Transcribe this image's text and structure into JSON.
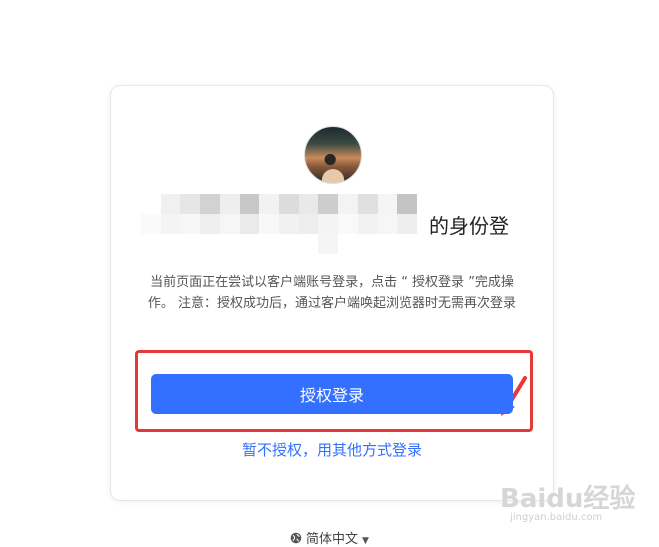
{
  "card": {
    "identity_suffix": "的身份登",
    "description": "当前页面正在尝试以客户端账号登录，点击 “ 授权登录 ”完成操作。 注意：授权成功后，通过客户端唤起浏览器时无需再次登录",
    "authorize_button_label": "授权登录",
    "alt_login_link": "暂不授权，用其他方式登录"
  },
  "footer": {
    "language_label": "简体中文"
  },
  "watermark": {
    "brand": "Baidu经验",
    "url": "jingyan.baidu.com"
  },
  "colors": {
    "accent": "#3370ff",
    "highlight_border": "#e53935",
    "annotation_arrow": "#e53935"
  },
  "icons": [
    "avatar",
    "globe-icon",
    "caret-down-icon",
    "red-arrow-annotation",
    "baidu-paw-icon"
  ]
}
